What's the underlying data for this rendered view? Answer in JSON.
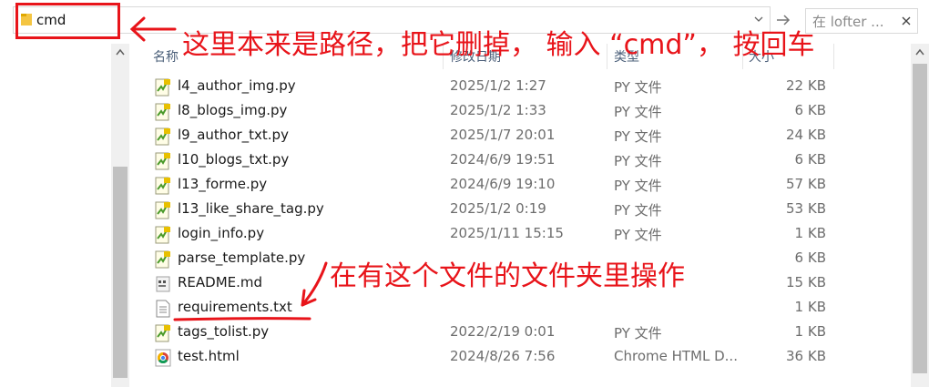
{
  "address_bar": {
    "value": "cmd"
  },
  "search": {
    "placeholder": "在 lofter ..."
  },
  "columns": {
    "name": "名称",
    "date": "修改日期",
    "type": "类型",
    "size": "大小"
  },
  "files": [
    {
      "name": "l4_author_img.py",
      "date": "2025/1/2 1:27",
      "type": "PY 文件",
      "size": "22 KB",
      "icon": "python-file-icon"
    },
    {
      "name": "l8_blogs_img.py",
      "date": "2025/1/2 1:33",
      "type": "PY 文件",
      "size": "6 KB",
      "icon": "python-file-icon"
    },
    {
      "name": "l9_author_txt.py",
      "date": "2025/1/7 20:01",
      "type": "PY 文件",
      "size": "24 KB",
      "icon": "python-file-icon"
    },
    {
      "name": "l10_blogs_txt.py",
      "date": "2024/6/9 19:51",
      "type": "PY 文件",
      "size": "6 KB",
      "icon": "python-file-icon"
    },
    {
      "name": "l13_forme.py",
      "date": "2024/6/9 19:10",
      "type": "PY 文件",
      "size": "57 KB",
      "icon": "python-file-icon"
    },
    {
      "name": "l13_like_share_tag.py",
      "date": "2025/1/2 0:19",
      "type": "PY 文件",
      "size": "53 KB",
      "icon": "python-file-icon"
    },
    {
      "name": "login_info.py",
      "date": "2025/1/11 15:15",
      "type": "PY 文件",
      "size": "1 KB",
      "icon": "python-file-icon"
    },
    {
      "name": "parse_template.py",
      "date": "",
      "type": "",
      "size": "6 KB",
      "icon": "python-file-icon"
    },
    {
      "name": "README.md",
      "date": "",
      "type": "",
      "size": "15 KB",
      "icon": "md-file-icon"
    },
    {
      "name": "requirements.txt",
      "date": "",
      "type": "",
      "size": "1 KB",
      "icon": "text-file-icon"
    },
    {
      "name": "tags_tolist.py",
      "date": "2022/2/19 0:01",
      "type": "PY 文件",
      "size": "1 KB",
      "icon": "python-file-icon"
    },
    {
      "name": "test.html",
      "date": "2024/8/26 7:56",
      "type": "Chrome HTML D...",
      "size": "36 KB",
      "icon": "chrome-html-file-icon"
    }
  ],
  "annotations": {
    "top": "这里本来是路径，把它删掉， 输入 “cmd”， 按回车",
    "middle": "在有这个文件的文件夹里操作"
  },
  "colors": {
    "annotation": "#e8141a",
    "header_text": "#4c607a",
    "scrollbar_thumb": "#c1c1c1"
  }
}
